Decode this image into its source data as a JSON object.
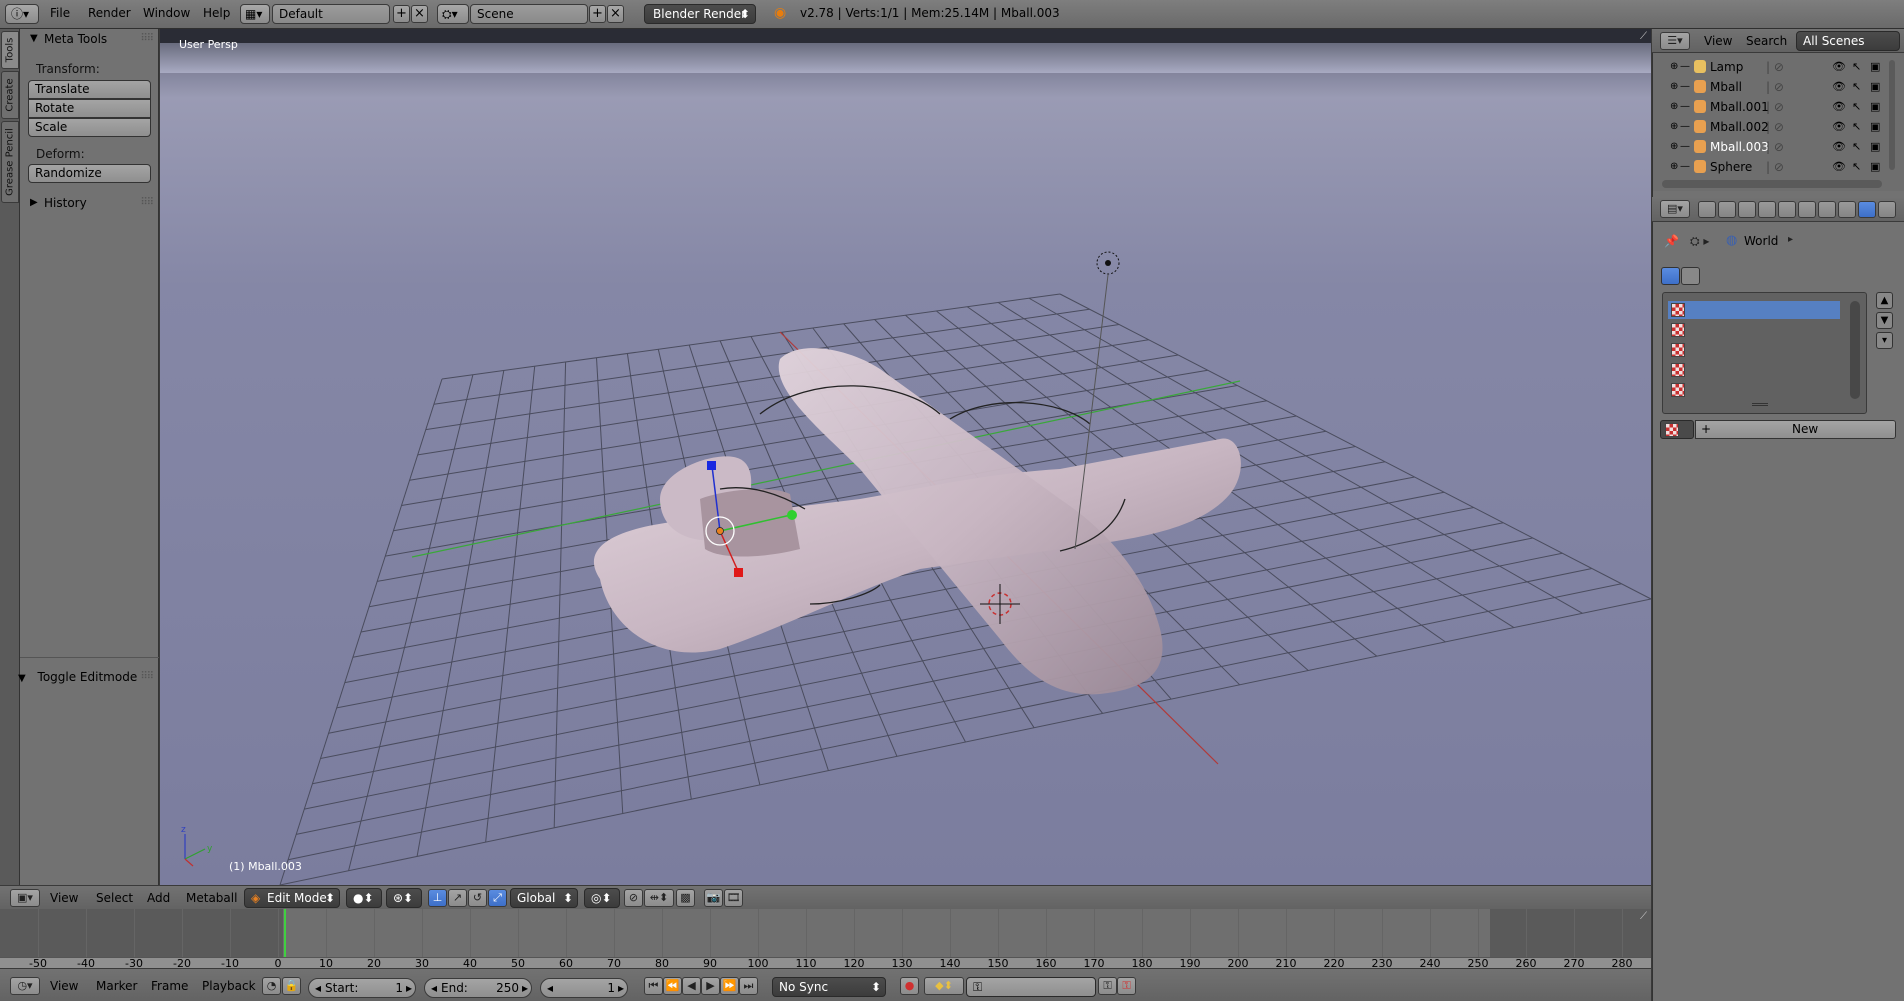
{
  "topbar": {
    "menus": [
      "File",
      "Render",
      "Window",
      "Help"
    ],
    "layout_name": "Default",
    "scene_name": "Scene",
    "engine": "Blender Render",
    "stats": "v2.78 | Verts:1/1 | Mem:25.14M | Mball.003"
  },
  "tabs": [
    "Tools",
    "Create",
    "Grease Pencil"
  ],
  "toolshelf": {
    "panel_title": "Meta Tools",
    "transform_label": "Transform:",
    "transform_buttons": [
      "Translate",
      "Rotate",
      "Scale"
    ],
    "deform_label": "Deform:",
    "deform_buttons": [
      "Randomize"
    ],
    "history_title": "History",
    "operator_panel": "Toggle Editmode"
  },
  "viewport": {
    "view_label": "User Persp",
    "object_label": "(1) Mball.003"
  },
  "viewport_header": {
    "menus": [
      "View",
      "Select",
      "Add",
      "Metaball"
    ],
    "mode": "Edit Mode",
    "orientation": "Global"
  },
  "timeline": {
    "ticks": [
      "-50",
      "-40",
      "-30",
      "-20",
      "-10",
      "0",
      "10",
      "20",
      "30",
      "40",
      "50",
      "60",
      "70",
      "80",
      "90",
      "100",
      "110",
      "120",
      "130",
      "140",
      "150",
      "160",
      "170",
      "180",
      "190",
      "200",
      "210",
      "220",
      "230",
      "240",
      "250",
      "260",
      "270",
      "280"
    ],
    "current_frame": 1
  },
  "timeline_header": {
    "menus": [
      "View",
      "Marker",
      "Frame",
      "Playback"
    ],
    "start_label": "Start:",
    "start_value": "1",
    "end_label": "End:",
    "end_value": "250",
    "current_value": "1",
    "sync": "No Sync"
  },
  "outliner": {
    "menus": [
      "View",
      "Search"
    ],
    "filter": "All Scenes",
    "items": [
      {
        "name": "Lamp",
        "color": "#e8c060"
      },
      {
        "name": "Mball",
        "color": "#e8a050"
      },
      {
        "name": "Mball.001",
        "color": "#e8a050"
      },
      {
        "name": "Mball.002",
        "color": "#e8a050"
      },
      {
        "name": "Mball.003",
        "color": "#e8a050"
      },
      {
        "name": "Sphere",
        "color": "#e8a050"
      }
    ]
  },
  "properties": {
    "breadcrumb": "World",
    "new_button": "New"
  },
  "colors": {
    "accent": "#5680c2",
    "x_axis": "#c03030",
    "y_axis": "#40b040",
    "z_axis": "#3040d0"
  }
}
